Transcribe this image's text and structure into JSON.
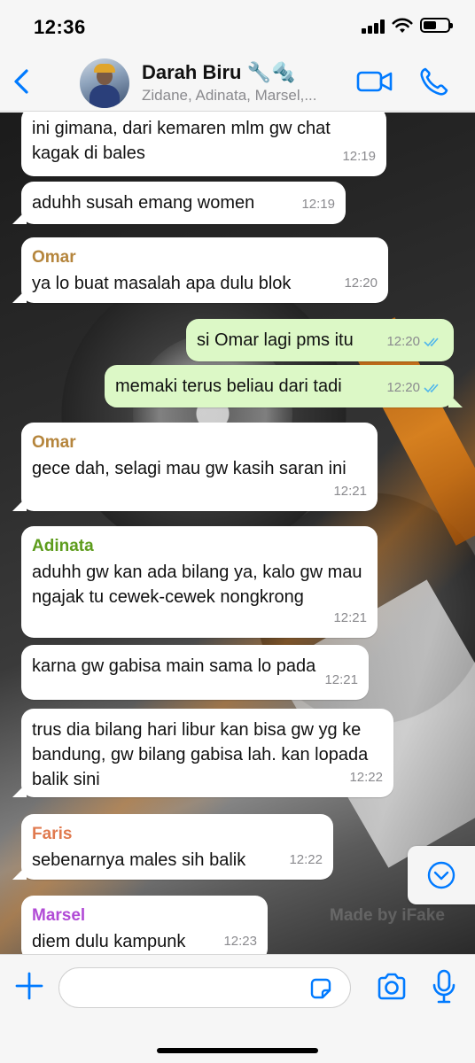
{
  "status_bar": {
    "time": "12:36",
    "battery_level": 0.55
  },
  "header": {
    "title": "Darah Biru 🔧🔩",
    "subtitle": "Zidane, Adinata, Marsel,...",
    "back_icon": "chevron-left-icon",
    "video_icon": "video-camera-icon",
    "call_icon": "phone-icon",
    "accent_color": "#007aff"
  },
  "messages": [
    {
      "direction": "in",
      "text": "ini gimana, dari kemaren mlm gw chat kagak di bales",
      "time": "12:19"
    },
    {
      "direction": "in",
      "text": "aduhh susah emang women",
      "time": "12:19"
    },
    {
      "direction": "in",
      "sender": "Omar",
      "sender_color": "#b5853c",
      "text": "ya lo buat masalah apa dulu blok",
      "time": "12:20"
    },
    {
      "direction": "out",
      "text": "si Omar lagi pms itu",
      "time": "12:20",
      "status": "read"
    },
    {
      "direction": "out",
      "text": "memaki terus beliau dari tadi",
      "time": "12:20",
      "status": "read"
    },
    {
      "direction": "in",
      "sender": "Omar",
      "sender_color": "#b5853c",
      "text": "gece dah, selagi mau gw kasih saran ini",
      "time": "12:21"
    },
    {
      "direction": "in",
      "sender": "Adinata",
      "sender_color": "#5d9c1c",
      "text": "aduhh gw kan ada bilang ya, kalo gw mau ngajak tu cewek-cewek nongkrong",
      "time": "12:21"
    },
    {
      "direction": "in",
      "text": "karna gw gabisa main sama lo pada",
      "time": "12:21"
    },
    {
      "direction": "in",
      "text": "trus dia bilang hari libur kan bisa gw yg ke bandung, gw bilang gabisa lah. kan lopada balik sini",
      "time": "12:22"
    },
    {
      "direction": "in",
      "sender": "Faris",
      "sender_color": "#e07a4f",
      "text": "sebenarnya males sih balik",
      "time": "12:22"
    },
    {
      "direction": "in",
      "sender": "Marsel",
      "sender_color": "#b14bd6",
      "text": "diem dulu kampunk",
      "time": "12:23"
    }
  ],
  "watermark": "Made by iFake",
  "scroll_down_icon": "chevron-down-circle-icon",
  "input_bar": {
    "placeholder": "",
    "plus_icon": "plus-icon",
    "sticker_icon": "sticker-icon",
    "camera_icon": "camera-icon",
    "mic_icon": "microphone-icon"
  }
}
